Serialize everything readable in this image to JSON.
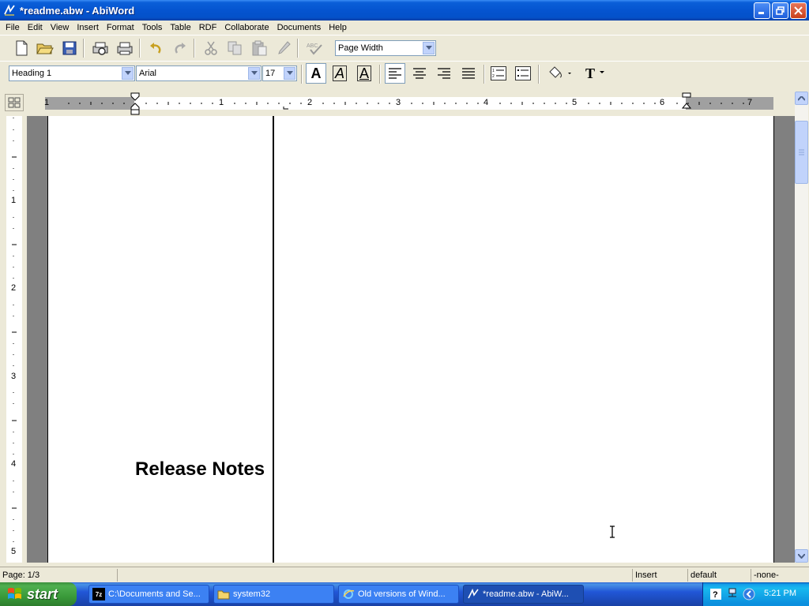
{
  "window": {
    "title": "*readme.abw - AbiWord"
  },
  "menu": [
    "File",
    "Edit",
    "View",
    "Insert",
    "Format",
    "Tools",
    "Table",
    "RDF",
    "Collaborate",
    "Documents",
    "Help"
  ],
  "toolbar": {
    "zoom": "Page Width",
    "style": "Heading 1",
    "font": "Arial",
    "size": "17",
    "bold": "A",
    "italic": "A",
    "underline": "A",
    "text_label": "T"
  },
  "ruler": {
    "h_labels": [
      "1",
      "1",
      "2",
      "3",
      "4",
      "5",
      "6",
      "7"
    ],
    "v_labels": [
      "1",
      "2",
      "3",
      "4",
      "5"
    ]
  },
  "document": {
    "heading": "Release Notes"
  },
  "status": {
    "page": "Page: 1/3",
    "mode": "Insert",
    "lang": "default",
    "extra": "-none-"
  },
  "taskbar": {
    "start": "start",
    "tasks": [
      {
        "label": "C:\\Documents and Se..."
      },
      {
        "label": "system32"
      },
      {
        "label": "Old versions of Wind..."
      },
      {
        "label": "*readme.abw - AbiW..."
      }
    ],
    "clock": "5:21 PM"
  },
  "colors": {
    "titlebar": "#0554d0",
    "taskbar": "#2157d7",
    "start": "#3a9a3a"
  }
}
